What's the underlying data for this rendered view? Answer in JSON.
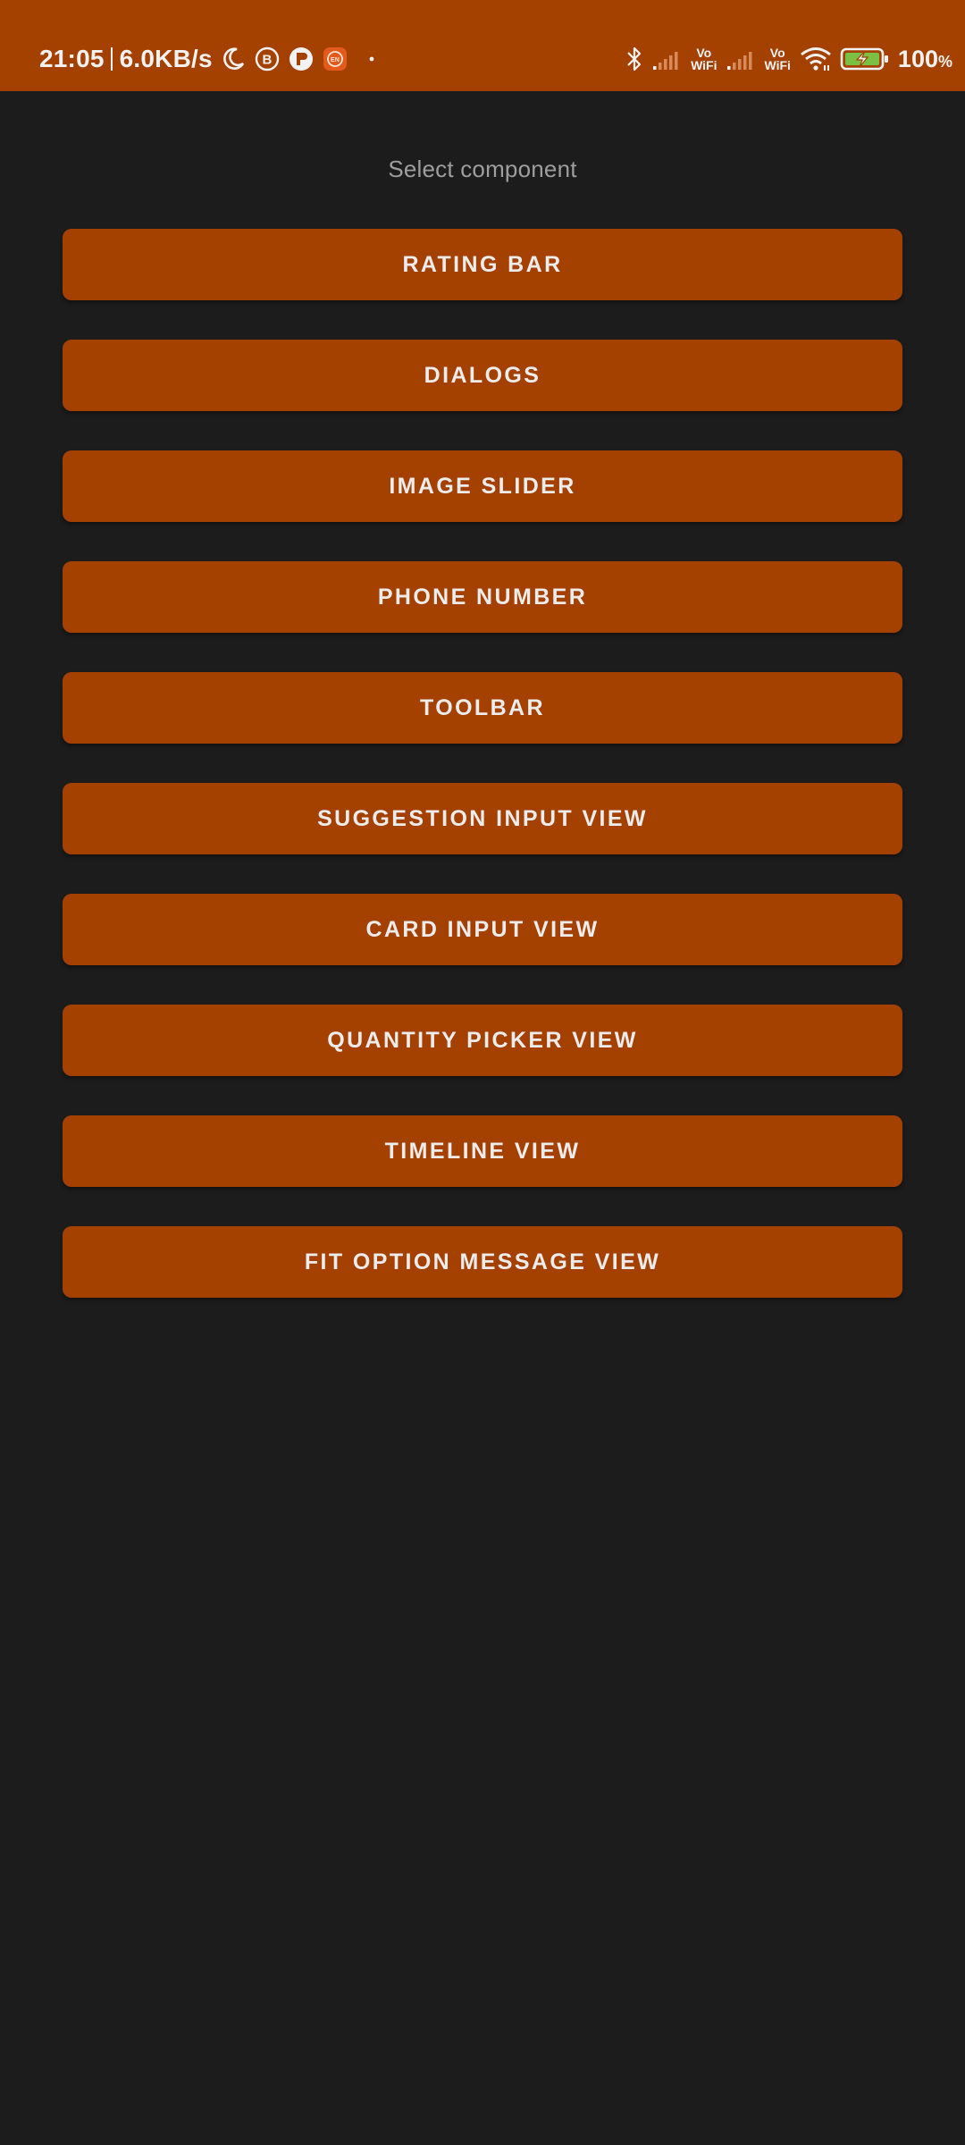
{
  "status_bar": {
    "time": "21:05",
    "network_speed": "6.0KB/s",
    "left_icons": [
      "moon-icon",
      "b-badge-icon",
      "p-app-icon",
      "en-app-icon",
      "dot-icon"
    ],
    "right_icons": [
      "bluetooth-icon",
      "signal-icon",
      "vowifi-icon",
      "signal-icon",
      "vowifi-icon",
      "wifi-icon",
      "battery-charging-icon"
    ],
    "vowifi_top": "Vo",
    "vowifi_bottom": "WiFi",
    "battery_value": "100",
    "battery_unit": "%"
  },
  "main": {
    "title": "Select component",
    "buttons": [
      {
        "label": "RATING BAR"
      },
      {
        "label": "DIALOGS"
      },
      {
        "label": "IMAGE SLIDER"
      },
      {
        "label": "PHONE NUMBER"
      },
      {
        "label": "TOOLBAR"
      },
      {
        "label": "SUGGESTION INPUT VIEW"
      },
      {
        "label": "CARD INPUT VIEW"
      },
      {
        "label": "QUANTITY PICKER VIEW"
      },
      {
        "label": "TIMELINE VIEW"
      },
      {
        "label": "FIT OPTION MESSAGE VIEW"
      }
    ]
  },
  "colors": {
    "accent": "#a44000",
    "background": "#1c1c1c",
    "title_text": "#9e9e9e",
    "button_text": "#ececec"
  }
}
